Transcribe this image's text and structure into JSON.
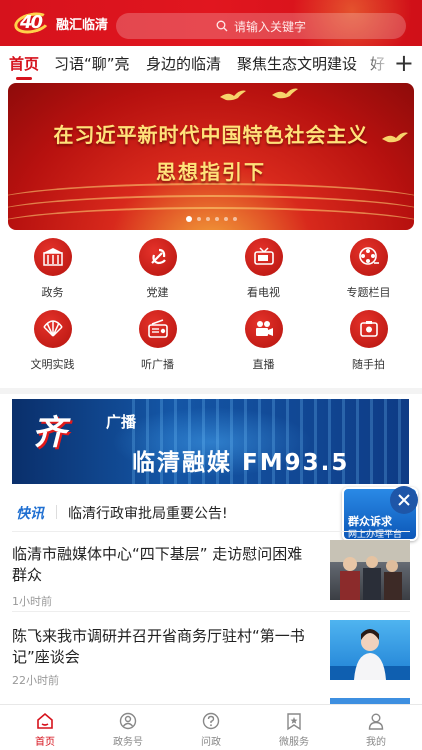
{
  "header": {
    "logo_number": "40",
    "logo_text": "融汇临清",
    "search_placeholder": "请输入关键字"
  },
  "tabs": [
    {
      "label": "首页",
      "active": true
    },
    {
      "label": "习语“聊”亮",
      "active": false
    },
    {
      "label": "身边的临清",
      "active": false
    },
    {
      "label": "聚焦生态文明建设",
      "active": false
    },
    {
      "label": "好",
      "active": false
    }
  ],
  "tab_add_icon": "plus-icon",
  "banner": {
    "line1": "在习近平新时代中国特色社会主义",
    "line2": "思想指引下",
    "slide_count": 6,
    "active_slide": 1
  },
  "grid": [
    {
      "label": "政务",
      "icon": "government-building-icon"
    },
    {
      "label": "党建",
      "icon": "party-emblem-icon"
    },
    {
      "label": "看电视",
      "icon": "tv-icon"
    },
    {
      "label": "专题栏目",
      "icon": "film-reel-icon"
    },
    {
      "label": "文明实践",
      "icon": "fan-icon"
    },
    {
      "label": "听广播",
      "icon": "radio-icon"
    },
    {
      "label": "直播",
      "icon": "video-camera-icon"
    },
    {
      "label": "随手拍",
      "icon": "phone-camera-icon"
    }
  ],
  "radio_banner": {
    "badge": "齐",
    "kind": "广播",
    "title": "临清融媒 FM93.5"
  },
  "flash": {
    "tag": "快讯",
    "text": "临清行政审批局重要公告!"
  },
  "float_ad": {
    "line1": "群众诉求",
    "line2": "网上办理平台"
  },
  "news": [
    {
      "title": "临清市融媒体中心“四下基层” 走访慰问困难群众",
      "time": "1小时前"
    },
    {
      "title": "陈飞来我市调研并召开省商务厅驻村“第一书记”座谈会",
      "time": "22小时前"
    }
  ],
  "bottom_nav": [
    {
      "label": "首页",
      "icon": "home-icon",
      "active": true
    },
    {
      "label": "政务号",
      "icon": "badge-icon",
      "active": false
    },
    {
      "label": "问政",
      "icon": "question-icon",
      "active": false
    },
    {
      "label": "微服务",
      "icon": "star-bookmark-icon",
      "active": false
    },
    {
      "label": "我的",
      "icon": "user-icon",
      "active": false
    }
  ],
  "colors": {
    "primary": "#d6121c",
    "flash_tag": "#1f6fd1"
  }
}
